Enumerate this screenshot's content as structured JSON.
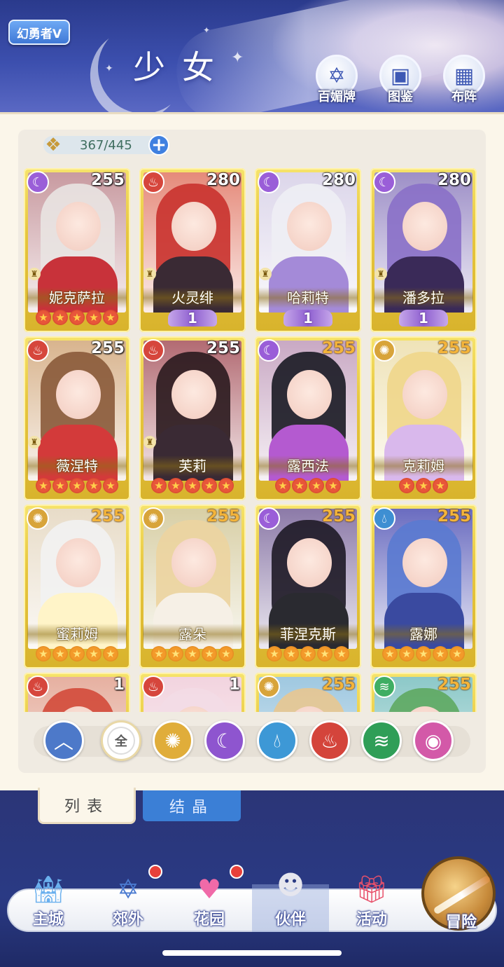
{
  "header": {
    "player_badge": "幻勇者V",
    "title": "少女",
    "buttons": [
      {
        "label": "百媚牌",
        "icon": "card-deck-icon"
      },
      {
        "label": "图鉴",
        "icon": "book-icon"
      },
      {
        "label": "布阵",
        "icon": "grid-icon"
      }
    ]
  },
  "inventory": {
    "count_text": "367/445"
  },
  "colors": {
    "moon": "#9a5ed8",
    "fire": "#d6463c",
    "sun": "#d8a43a",
    "water": "#3e8fd2",
    "wind": "#3fae63",
    "card_gold": "#e7c63e"
  },
  "cards": [
    {
      "name": "妮克萨拉",
      "level": "255",
      "element": "moon",
      "stars": 5,
      "wing": "",
      "hair": "#e9e4e2",
      "outfit": "#c8323a",
      "bg": "#c89aa0"
    },
    {
      "name": "火灵绯",
      "level": "280",
      "element": "fire",
      "stars": 0,
      "wing": "1",
      "hair": "#c9322e",
      "outfit": "#3a2a34",
      "bg": "#e58a7a"
    },
    {
      "name": "哈莉特",
      "level": "280",
      "element": "moon",
      "stars": 0,
      "wing": "1",
      "hair": "#eeeef4",
      "outfit": "#a48ad8",
      "bg": "#dcd6ea"
    },
    {
      "name": "潘多拉",
      "level": "280",
      "element": "moon",
      "stars": 0,
      "wing": "1",
      "hair": "#8a70c8",
      "outfit": "#3a2a58",
      "bg": "#9d8fc7"
    },
    {
      "name": "薇涅特",
      "level": "255",
      "element": "fire",
      "stars": 5,
      "wing": "",
      "hair": "#8a5a3a",
      "outfit": "#d33a3a",
      "bg": "#d8b48e"
    },
    {
      "name": "芙莉",
      "level": "255",
      "element": "fire",
      "stars": 5,
      "wing": "",
      "hair": "#2a1a1e",
      "outfit": "#3a2a34",
      "bg": "#b26a72"
    },
    {
      "name": "露西法",
      "level": "255",
      "element": "moon",
      "stars": 4,
      "wing": "",
      "hair": "#1a1a24",
      "outfit": "#b45ad0",
      "bg": "#c9a9c4"
    },
    {
      "name": "克莉姆",
      "level": "255",
      "element": "sun",
      "stars": 3,
      "wing": "",
      "hair": "#f0d68a",
      "outfit": "#d9b8ec",
      "bg": "#efe3b8"
    },
    {
      "name": "蜜莉姆",
      "level": "255",
      "element": "sun",
      "stars": 5,
      "wing": "",
      "hair": "#f2f2f2",
      "outfit": "#fff4c8",
      "bg": "#e8dcc8"
    },
    {
      "name": "露朵",
      "level": "255",
      "element": "sun",
      "stars": 5,
      "wing": "",
      "hair": "#ecd4a0",
      "outfit": "#f6f0e6",
      "bg": "#d8cfa6"
    },
    {
      "name": "菲涅克斯",
      "level": "255",
      "element": "moon",
      "stars": 5,
      "wing": "",
      "hair": "#1e1a26",
      "outfit": "#2a2a30",
      "bg": "#8c7aa8"
    },
    {
      "name": "露娜",
      "level": "255",
      "element": "water",
      "stars": 5,
      "wing": "",
      "hair": "#5a7ad0",
      "outfit": "#3a4aa0",
      "bg": "#6a6cc0"
    },
    {
      "name": "",
      "level": "1",
      "element": "fire",
      "stars": 0,
      "wing": "",
      "hair": "#d34a3a",
      "outfit": "#d34a3a",
      "bg": "#e6b0a0"
    },
    {
      "name": "",
      "level": "1",
      "element": "fire",
      "stars": 0,
      "wing": "",
      "hair": "#f3dbe6",
      "outfit": "#f3dbe6",
      "bg": "#f2d4df"
    },
    {
      "name": "",
      "level": "255",
      "element": "sun",
      "stars": 0,
      "wing": "",
      "hair": "#e8c690",
      "outfit": "#e8c690",
      "bg": "#9fc8e0"
    },
    {
      "name": "",
      "level": "255",
      "element": "wind",
      "stars": 0,
      "wing": "",
      "hair": "#5ea860",
      "outfit": "#5ea860",
      "bg": "#8cc8c8"
    }
  ],
  "filters": {
    "all_label": "全",
    "items": [
      "up-arrow-icon",
      "sun-icon",
      "moon-icon",
      "water-drop-icon",
      "fire-icon",
      "wind-icon",
      "orb-icon"
    ]
  },
  "tabs": {
    "list": "列表",
    "crystal": "结晶"
  },
  "nav": [
    {
      "label": "主城",
      "icon": "castle-icon",
      "dot": false
    },
    {
      "label": "郊外",
      "icon": "magic-gate-icon",
      "dot": true
    },
    {
      "label": "花园",
      "icon": "heart-icon",
      "dot": true
    },
    {
      "label": "伙伴",
      "icon": "companion-portrait-icon",
      "dot": false
    },
    {
      "label": "活动",
      "icon": "gift-box-icon",
      "dot": false
    }
  ],
  "adventure_label": "冒险"
}
